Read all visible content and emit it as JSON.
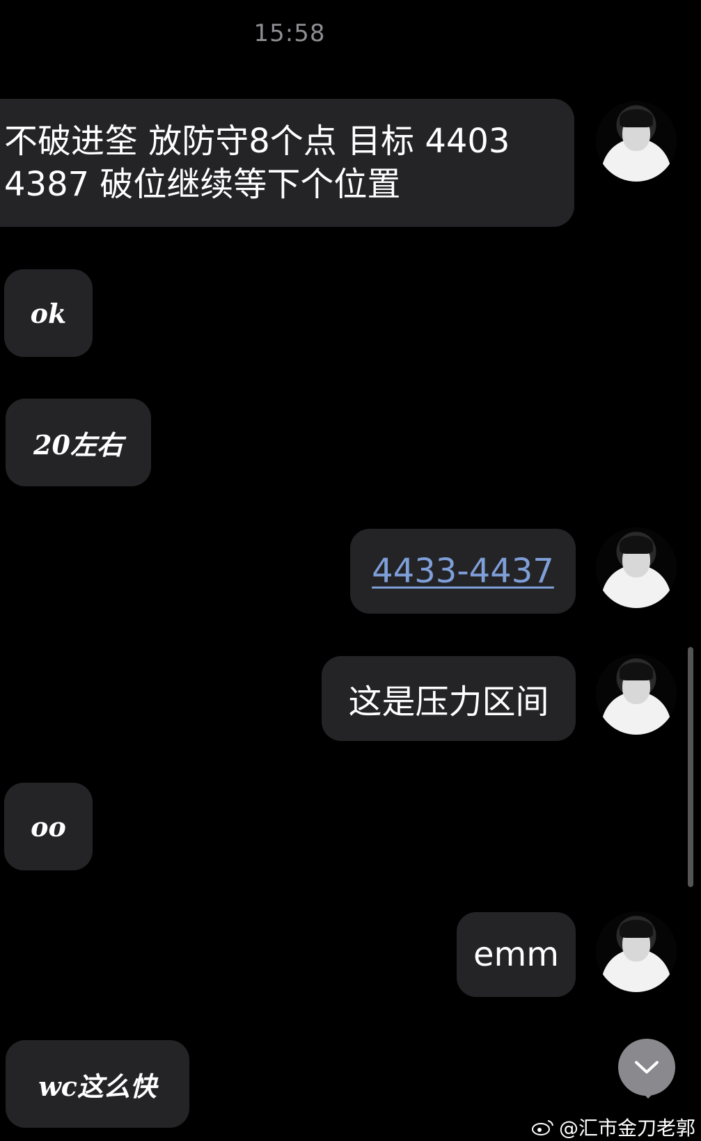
{
  "timestamp": "15:58",
  "messages": [
    {
      "side": "right",
      "text": "不破进筌 放防守8个点 目标 4403 4387  破位继续等下个位置"
    },
    {
      "side": "left",
      "text": "ok"
    },
    {
      "side": "left",
      "text": "20左右"
    },
    {
      "side": "right",
      "text": "4433-4437",
      "link": true
    },
    {
      "side": "right",
      "text": "这是压力区间"
    },
    {
      "side": "left",
      "text": "oo"
    },
    {
      "side": "right",
      "text": "emm"
    },
    {
      "side": "left",
      "text": "wc这么快"
    }
  ],
  "icons": {
    "scroll_down": "chevron-down-icon",
    "watermark_logo": "weibo-icon",
    "avatar": "avatar"
  },
  "watermark": "@汇市金刀老郭",
  "colors": {
    "background": "#000000",
    "bubble": "#242427",
    "link": "#7f9fd9",
    "timestamp": "#8e8e93",
    "scroll_button": "#8a8a8e"
  }
}
